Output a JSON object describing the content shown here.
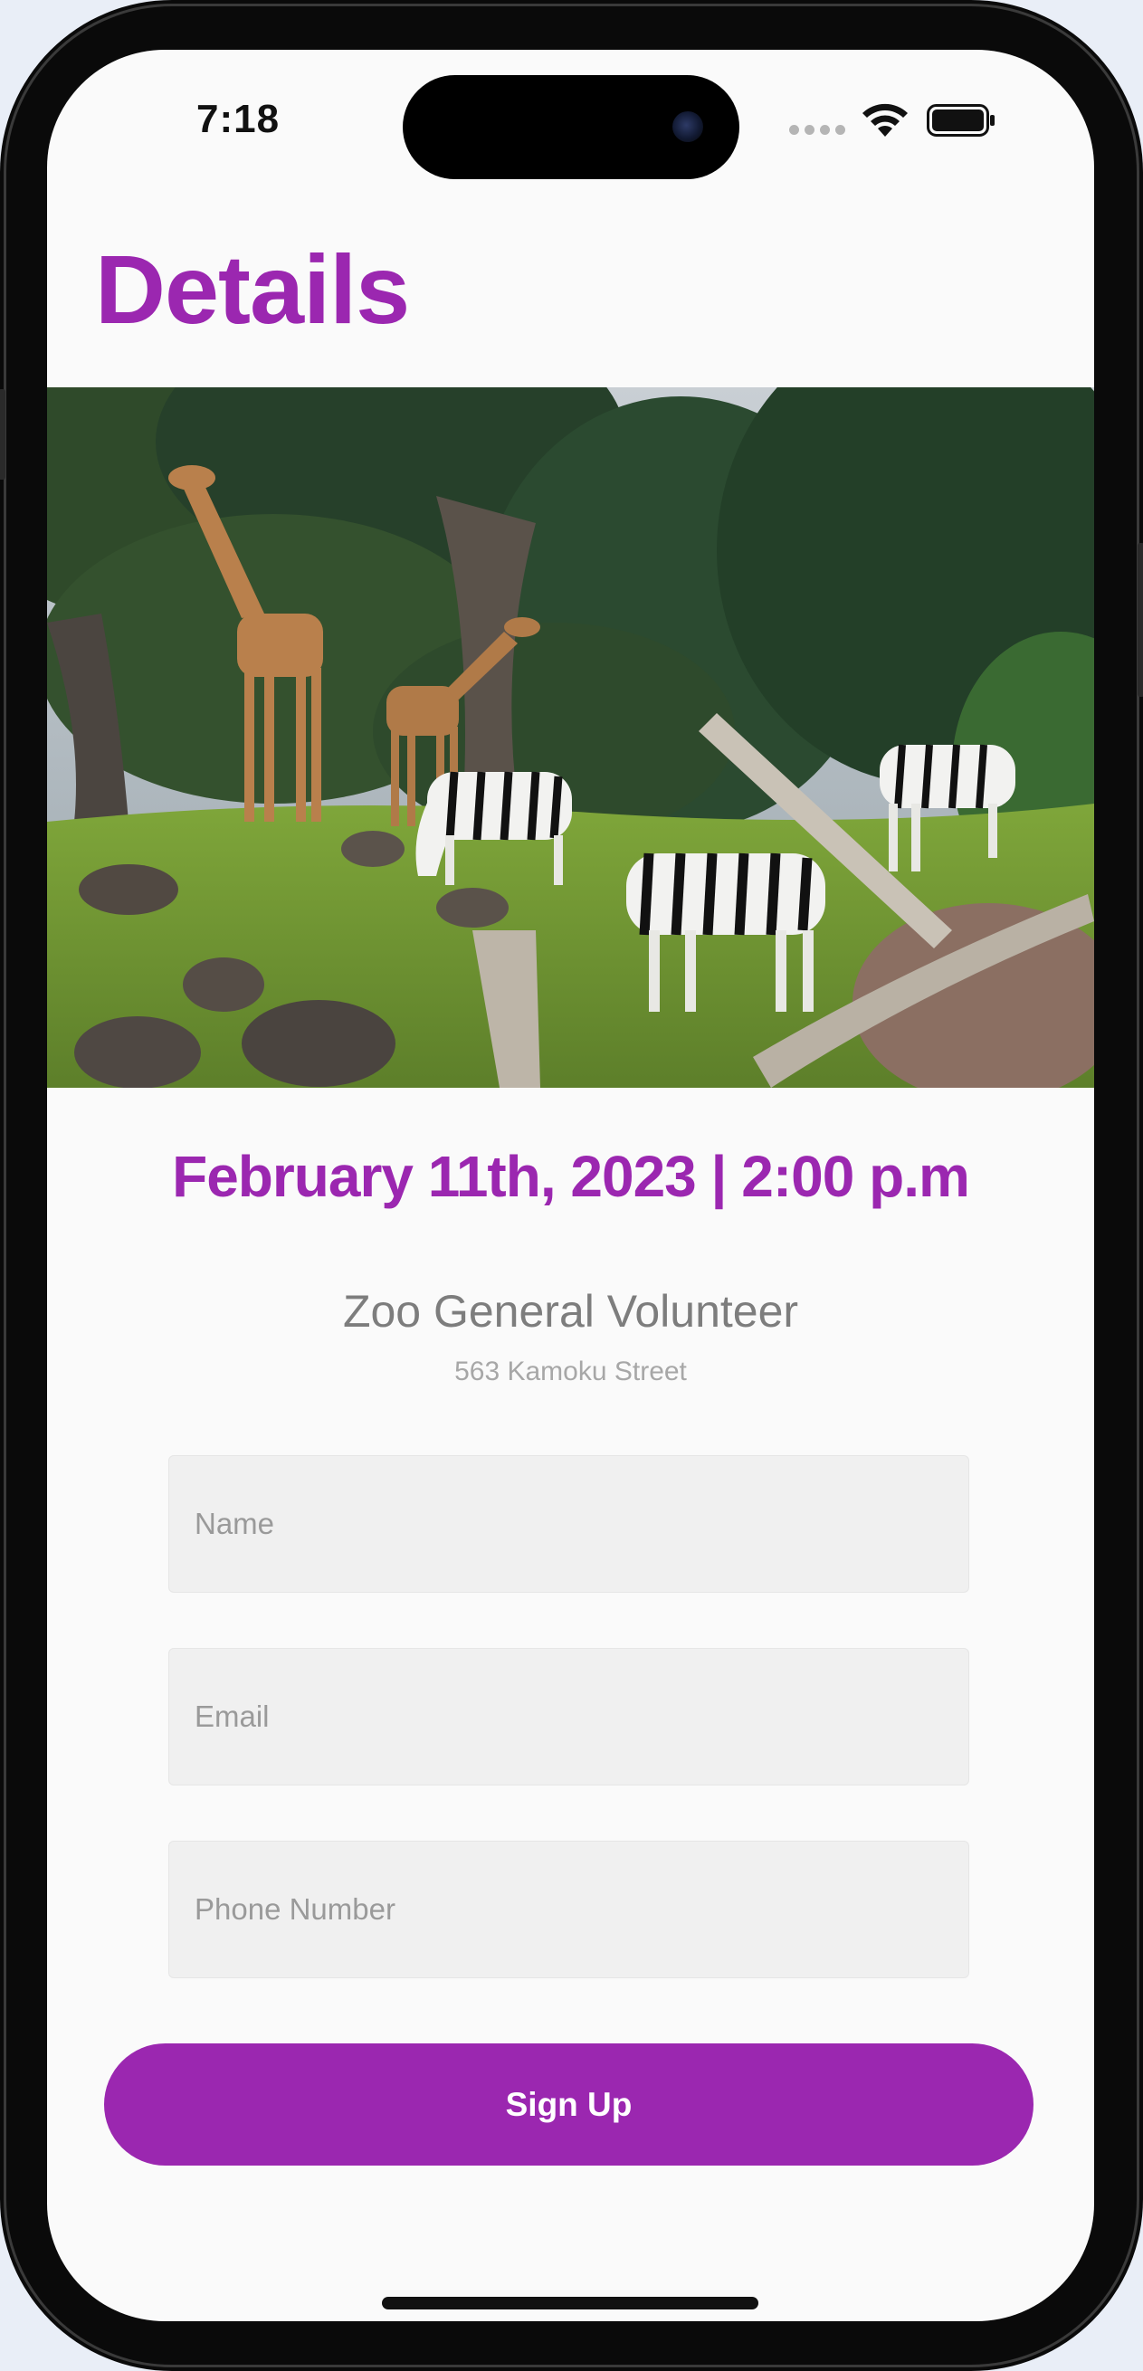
{
  "status_bar": {
    "time": "7:18"
  },
  "header": {
    "title": "Details"
  },
  "hero": {
    "icon": "zoo-photo-giraffes-zebras"
  },
  "event": {
    "datetime": "February 11th, 2023 | 2:00 p.m",
    "name": "Zoo General Volunteer",
    "address": "563 Kamoku Street"
  },
  "form": {
    "name_placeholder": "Name",
    "email_placeholder": "Email",
    "phone_placeholder": "Phone Number",
    "submit_label": "Sign Up"
  },
  "colors": {
    "accent": "#9b27b0",
    "input_bg": "#f0f0f0",
    "text_muted": "#7d7d7d"
  }
}
